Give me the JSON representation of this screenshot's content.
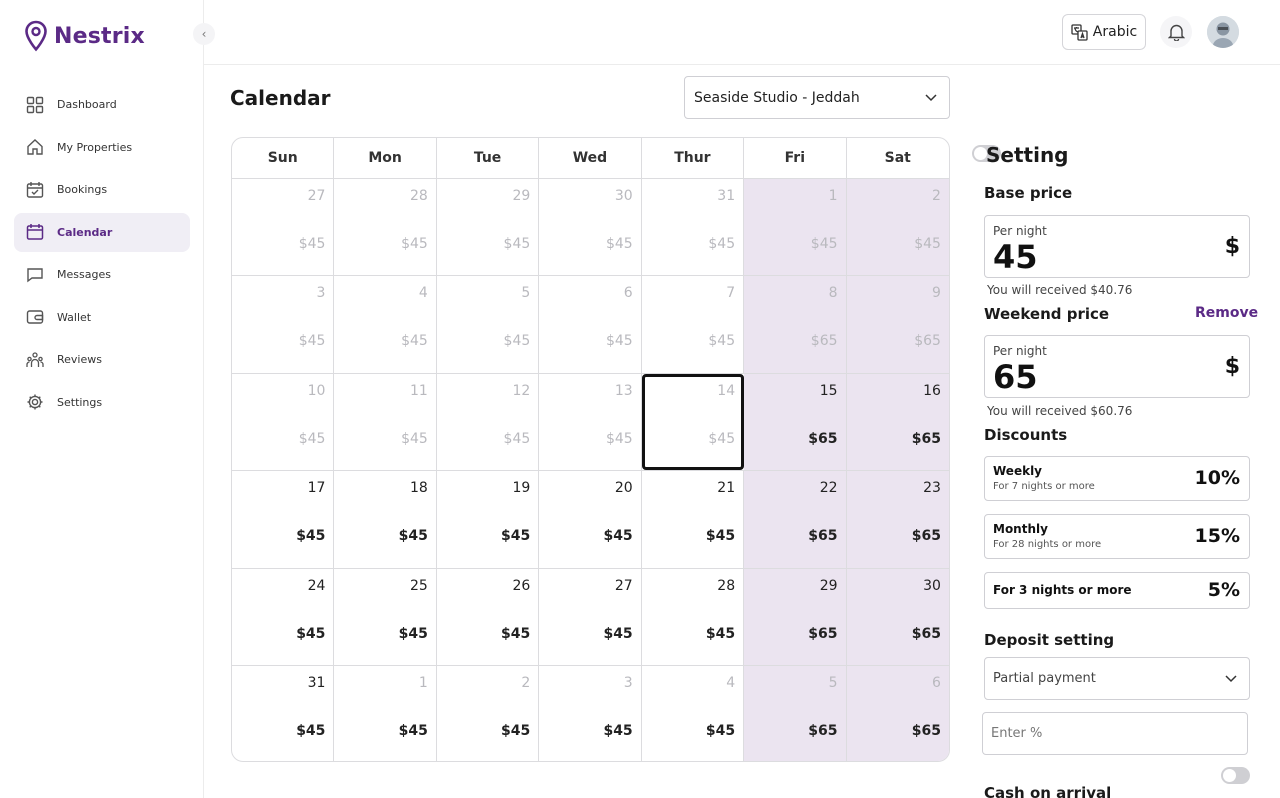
{
  "brand": {
    "name": "Nestrix",
    "color": "#5b2a86"
  },
  "sidebar": {
    "items": [
      {
        "label": "Dashboard",
        "icon": "dashboard-icon"
      },
      {
        "label": "My Properties",
        "icon": "home-icon"
      },
      {
        "label": "Bookings",
        "icon": "calendar-check-icon"
      },
      {
        "label": "Calendar",
        "icon": "calendar-icon",
        "active": true
      },
      {
        "label": "Messages",
        "icon": "chat-icon"
      },
      {
        "label": "Wallet",
        "icon": "wallet-icon"
      },
      {
        "label": "Reviews",
        "icon": "reviews-icon"
      },
      {
        "label": "Settings",
        "icon": "gear-icon"
      }
    ]
  },
  "topbar": {
    "language_label": "Arabic"
  },
  "page": {
    "title": "Calendar",
    "property": "Seaside Studio - Jeddah"
  },
  "calendar": {
    "weekdays": [
      "Sun",
      "Mon",
      "Tue",
      "Wed",
      "Thur",
      "Fri",
      "Sat"
    ],
    "weeks": [
      [
        {
          "day": "27",
          "price": "$45",
          "muted": true
        },
        {
          "day": "28",
          "price": "$45",
          "muted": true
        },
        {
          "day": "29",
          "price": "$45",
          "muted": true
        },
        {
          "day": "30",
          "price": "$45",
          "muted": true
        },
        {
          "day": "31",
          "price": "$45",
          "muted": true
        },
        {
          "day": "1",
          "price": "$45",
          "muted": true
        },
        {
          "day": "2",
          "price": "$45",
          "muted": true
        }
      ],
      [
        {
          "day": "3",
          "price": "$45",
          "muted": true
        },
        {
          "day": "4",
          "price": "$45",
          "muted": true
        },
        {
          "day": "5",
          "price": "$45",
          "muted": true
        },
        {
          "day": "6",
          "price": "$45",
          "muted": true
        },
        {
          "day": "7",
          "price": "$45",
          "muted": true
        },
        {
          "day": "8",
          "price": "$65",
          "muted": true
        },
        {
          "day": "9",
          "price": "$65",
          "muted": true
        }
      ],
      [
        {
          "day": "10",
          "price": "$45",
          "muted": true
        },
        {
          "day": "11",
          "price": "$45",
          "muted": true
        },
        {
          "day": "12",
          "price": "$45",
          "muted": true
        },
        {
          "day": "13",
          "price": "$45",
          "muted": true
        },
        {
          "day": "14",
          "price": "$45",
          "muted": true,
          "today": true
        },
        {
          "day": "15",
          "price": "$65",
          "muted": false
        },
        {
          "day": "16",
          "price": "$65",
          "muted": false
        }
      ],
      [
        {
          "day": "17",
          "price": "$45",
          "muted": false
        },
        {
          "day": "18",
          "price": "$45",
          "muted": false
        },
        {
          "day": "19",
          "price": "$45",
          "muted": false
        },
        {
          "day": "20",
          "price": "$45",
          "muted": false
        },
        {
          "day": "21",
          "price": "$45",
          "muted": false
        },
        {
          "day": "22",
          "price": "$65",
          "muted": false
        },
        {
          "day": "23",
          "price": "$65",
          "muted": false
        }
      ],
      [
        {
          "day": "24",
          "price": "$45",
          "muted": false
        },
        {
          "day": "25",
          "price": "$45",
          "muted": false
        },
        {
          "day": "26",
          "price": "$45",
          "muted": false
        },
        {
          "day": "27",
          "price": "$45",
          "muted": false
        },
        {
          "day": "28",
          "price": "$45",
          "muted": false
        },
        {
          "day": "29",
          "price": "$65",
          "muted": false
        },
        {
          "day": "30",
          "price": "$65",
          "muted": false
        }
      ],
      [
        {
          "day": "31",
          "price": "$45",
          "muted": false
        },
        {
          "day": "1",
          "price": "$45",
          "muted": true,
          "muted_price": false
        },
        {
          "day": "2",
          "price": "$45",
          "muted": true,
          "muted_price": false
        },
        {
          "day": "3",
          "price": "$45",
          "muted": true,
          "muted_price": false
        },
        {
          "day": "4",
          "price": "$45",
          "muted": true,
          "muted_price": false
        },
        {
          "day": "5",
          "price": "$65",
          "muted": true,
          "muted_price": false
        },
        {
          "day": "6",
          "price": "$65",
          "muted": true,
          "muted_price": false
        }
      ]
    ],
    "weekend_color": "#ebe4f0"
  },
  "settings": {
    "title": "Setting",
    "base_price_label": "Base price",
    "base_price": {
      "per_night": "Per night",
      "value": "45",
      "currency": "$",
      "received": "You will received $40.76"
    },
    "weekend_price_label": "Weekend price",
    "remove_label": "Remove",
    "weekend_price": {
      "per_night": "Per night",
      "value": "65",
      "currency": "$",
      "received": "You will received $60.76"
    },
    "discounts_label": "Discounts",
    "discounts": [
      {
        "name": "Weekly",
        "sub": "For 7 nights or more",
        "pct": "10%"
      },
      {
        "name": "Monthly",
        "sub": "For 28 nights or more",
        "pct": "15%"
      },
      {
        "name": "For 3 nights or more",
        "sub": "",
        "pct": "5%"
      }
    ],
    "deposit_label": "Deposit setting",
    "deposit_option": "Partial payment",
    "deposit_placeholder": "Enter %",
    "cash_label": "Cash on arrival"
  }
}
